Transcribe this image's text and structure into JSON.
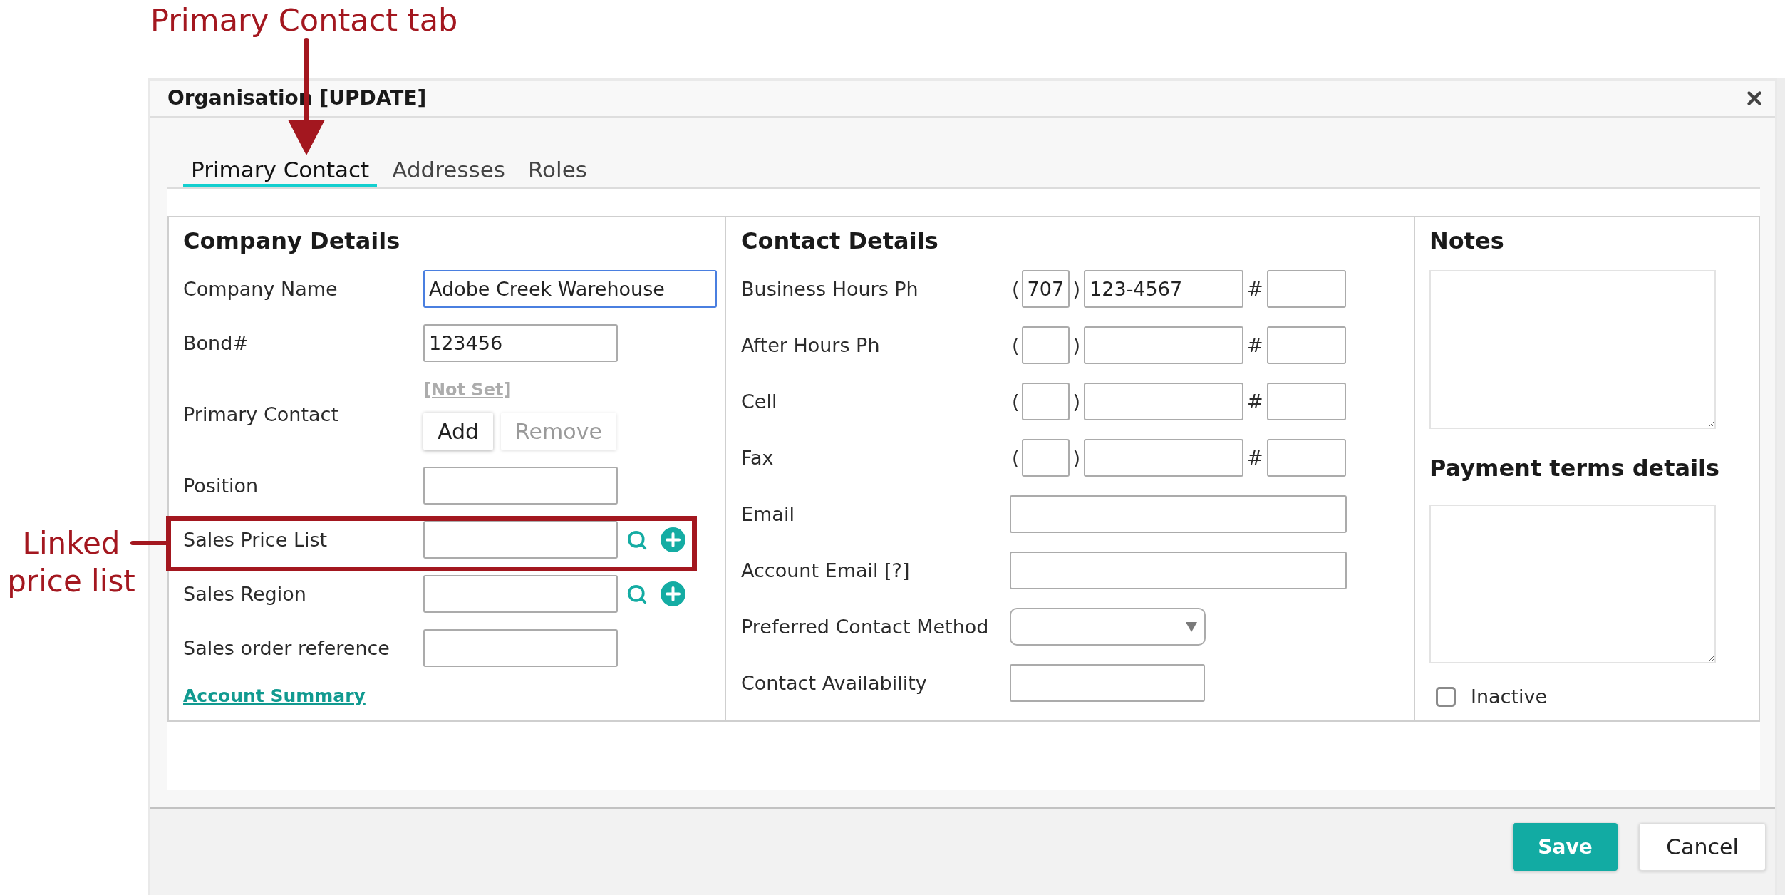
{
  "annotations": [
    {
      "kind": "arrow",
      "text": "Primary Contact tab"
    },
    {
      "kind": "frame",
      "text": "Linked price list"
    }
  ],
  "dialog": {
    "title": "Organisation [UPDATE]"
  },
  "tabs": [
    {
      "label": "Primary Contact",
      "selected": true
    },
    {
      "label": "Addresses",
      "selected": false
    },
    {
      "label": "Roles",
      "selected": false
    }
  ],
  "company_details": {
    "heading": "Company Details",
    "fields": [
      {
        "kind": "wide_text",
        "label": "Company Name",
        "value": "Adobe Creek Warehouse",
        "focused": true
      },
      {
        "kind": "text",
        "label": "Bond#",
        "value": "123456",
        "focused": false
      },
      {
        "kind": "contact_picker",
        "label": "Primary Contact",
        "link": "[Not Set]",
        "buttons": [
          {
            "label": "Add",
            "disabled": false
          },
          {
            "label": "Remove",
            "disabled": true
          }
        ]
      },
      {
        "kind": "text",
        "label": "Position",
        "focused": false
      },
      {
        "kind": "lookup",
        "label": "Sales Price List",
        "focused": false
      },
      {
        "kind": "lookup",
        "label": "Sales Region",
        "focused": false
      },
      {
        "kind": "text",
        "label": "Sales order reference",
        "focused": false
      }
    ],
    "link": "Account Summary"
  },
  "contact_details": {
    "heading": "Contact Details",
    "fields": [
      {
        "kind": "phone",
        "label": "Business Hours Ph",
        "open": "(",
        "area": "707",
        "close": ")",
        "number": "123-4567",
        "ext_sign": "#"
      },
      {
        "kind": "phone",
        "label": "After Hours Ph",
        "open": "(",
        "close": ")",
        "ext_sign": "#"
      },
      {
        "kind": "phone",
        "label": "Cell",
        "open": "(",
        "close": ")",
        "ext_sign": "#"
      },
      {
        "kind": "phone",
        "label": "Fax",
        "open": "(",
        "close": ")",
        "ext_sign": "#"
      },
      {
        "kind": "wide_text",
        "label": "Email"
      },
      {
        "kind": "wide_text",
        "label": "Account Email [?]"
      },
      {
        "kind": "select",
        "label": "Preferred Contact Method"
      },
      {
        "kind": "text",
        "label": "Contact Availability"
      }
    ]
  },
  "notes": {
    "heading": "Notes"
  },
  "payment_terms": {
    "heading": "Payment terms details"
  },
  "inactive": {
    "label": "Inactive",
    "checked": false
  },
  "footer_buttons": [
    {
      "kind": "primary",
      "label": "Save"
    },
    {
      "kind": "secondary",
      "label": "Cancel"
    }
  ]
}
